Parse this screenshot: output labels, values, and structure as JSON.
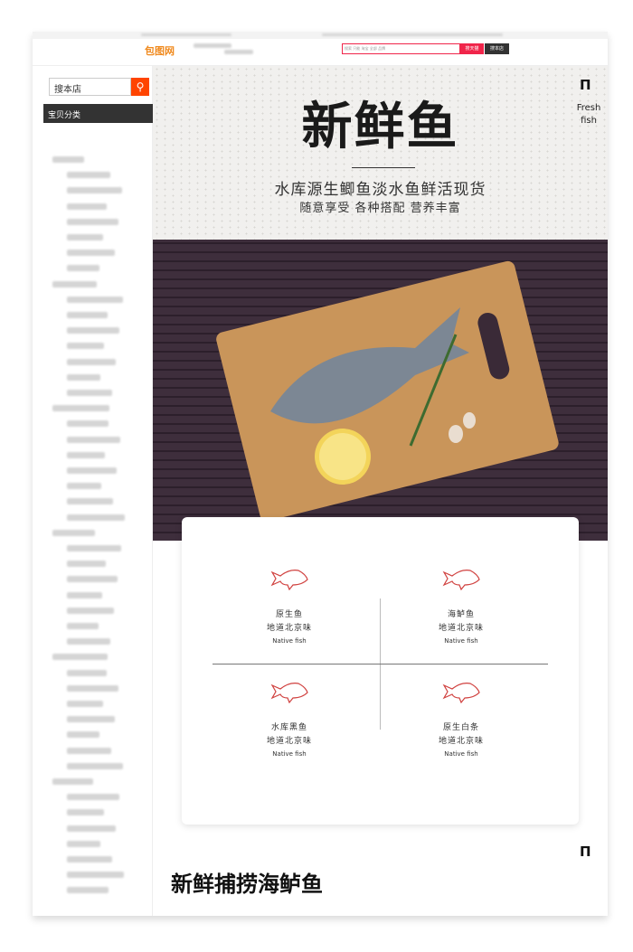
{
  "topbar": {
    "search_placeholder": "搜索 只能 淘宝 全部 品牌",
    "search_tmall": "搜天猫",
    "search_shop": "搜本店",
    "logo": "包图网"
  },
  "sidebar": {
    "search_value": "搜本店",
    "category_title": "宝贝分类",
    "search_icon": "search-icon"
  },
  "hero": {
    "title": "新鲜鱼",
    "subtitle": "水库源生鲫鱼淡水鱼鲜活现货",
    "tagline": "随意享受 各种搭配 营养丰富",
    "fresh": "Fresh",
    "fish": "fish"
  },
  "features": [
    {
      "name": "原生鱼",
      "desc": "地道北京味",
      "en": "Native fish"
    },
    {
      "name": "海鲈鱼",
      "desc": "地道北京味",
      "en": "Native fish"
    },
    {
      "name": "水库黑鱼",
      "desc": "地道北京味",
      "en": "Native fish"
    },
    {
      "name": "原生白条",
      "desc": "地道北京味",
      "en": "Native fish"
    }
  ],
  "section_title": "新鲜捕捞海鲈鱼",
  "colors": {
    "accent": "#ff4400",
    "search_red": "#f0254a",
    "icon_red": "#d0403e"
  }
}
